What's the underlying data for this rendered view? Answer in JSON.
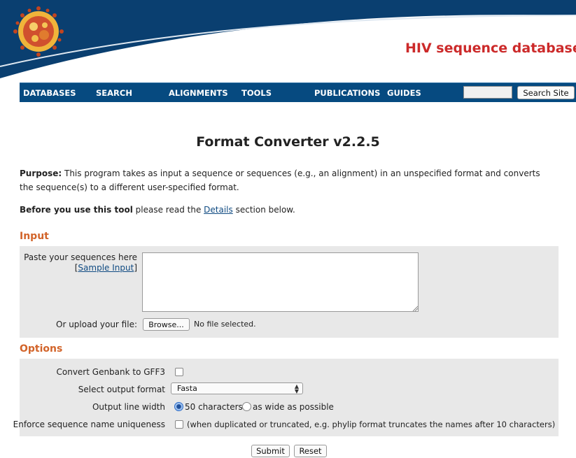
{
  "header": {
    "site_title": "HIV sequence database",
    "logo_icon": "hiv-virus-logo-icon",
    "colors": {
      "title": "#cc2a2a",
      "navbar": "#064a80",
      "swoosh": "#0a3f70"
    }
  },
  "nav": {
    "items": [
      {
        "label": "DATABASES"
      },
      {
        "label": "SEARCH"
      },
      {
        "label": "ALIGNMENTS"
      },
      {
        "label": "TOOLS"
      },
      {
        "label": "PUBLICATIONS"
      },
      {
        "label": "GUIDES"
      }
    ],
    "search_value": "",
    "search_button": "Search Site"
  },
  "page": {
    "title": "Format Converter v2.2.5",
    "purpose_label": "Purpose:",
    "purpose_text": "This program takes as input a sequence or sequences (e.g., an alignment) in an unspecified format and converts the sequence(s) to a different user-specified format.",
    "before_label": "Before you use this tool",
    "before_text_1": "please read the",
    "details_link": "Details",
    "before_text_2": "section below."
  },
  "input_section": {
    "heading": "Input",
    "paste_label": "Paste your sequences here",
    "sample_link": "Sample Input",
    "textarea_value": "",
    "upload_label": "Or upload your file:",
    "browse_button": "Browse...",
    "file_status": "No file selected."
  },
  "options_section": {
    "heading": "Options",
    "genbank_label": "Convert Genbank to GFF3",
    "genbank_checked": false,
    "format_label": "Select output format",
    "format_value": "Fasta",
    "width_label": "Output line width",
    "width_option_1": "50 characters",
    "width_option_2": "as wide as possible",
    "width_selected": "50 characters",
    "unique_label": "Enforce sequence name uniqueness",
    "unique_checked": false,
    "unique_note": "(when duplicated or truncated, e.g. phylip format truncates the names after 10 characters)"
  },
  "actions": {
    "submit": "Submit",
    "reset": "Reset"
  }
}
